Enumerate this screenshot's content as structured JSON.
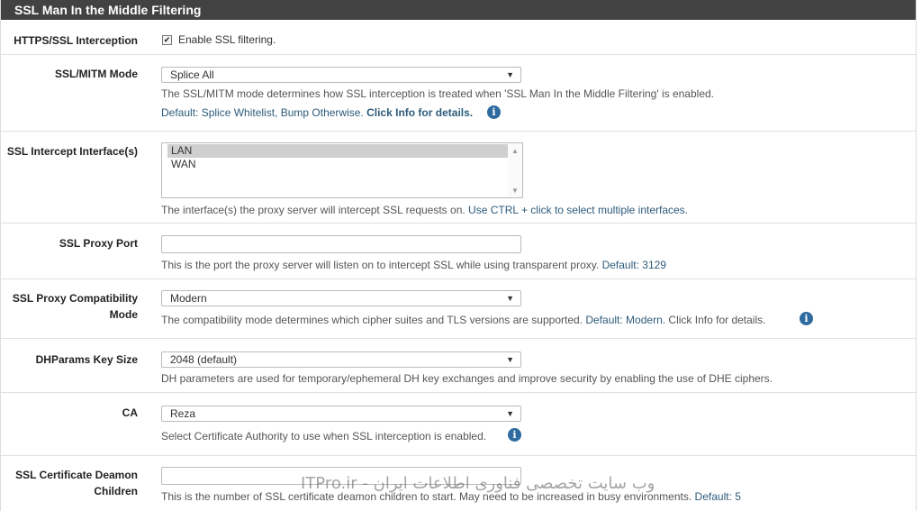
{
  "panel": {
    "title": "SSL Man In the Middle Filtering"
  },
  "https_interception": {
    "label": "HTTPS/SSL Interception",
    "checkbox_label": "Enable SSL filtering.",
    "checked": true
  },
  "mitm_mode": {
    "label": "SSL/MITM Mode",
    "value": "Splice All",
    "help": "The SSL/MITM mode determines how SSL interception is treated when 'SSL Man In the Middle Filtering' is enabled.",
    "default_text": "Default: Splice Whitelist, Bump Otherwise.",
    "info_link": "Click Info for details."
  },
  "intercept_interfaces": {
    "label": "SSL Intercept Interface(s)",
    "options": [
      "LAN",
      "WAN"
    ],
    "selected": "LAN",
    "help_prefix": "The interface(s) the proxy server will intercept SSL requests on.",
    "help_suffix": "Use CTRL + click to select multiple interfaces."
  },
  "proxy_port": {
    "label": "SSL Proxy Port",
    "value": "",
    "help": "This is the port the proxy server will listen on to intercept SSL while using transparent proxy.",
    "default_text": "Default: 3129"
  },
  "compat_mode": {
    "label_line1": "SSL Proxy Compatibility",
    "label_line2": "Mode",
    "value": "Modern",
    "help": "The compatibility mode determines which cipher suites and TLS versions are supported.",
    "default_text": "Default: Modern.",
    "info_text": "Click Info for details."
  },
  "dhparams": {
    "label": "DHParams Key Size",
    "value": "2048 (default)",
    "help": "DH parameters are used for temporary/ephemeral DH key exchanges and improve security by enabling the use of DHE ciphers."
  },
  "ca": {
    "label": "CA",
    "value": "Reza",
    "help": "Select Certificate Authority to use when SSL interception is enabled."
  },
  "cert_daemon": {
    "label_line1": "SSL Certificate Deamon",
    "label_line2": "Children",
    "value": "",
    "help": "This is the number of SSL certificate deamon children to start. May need to be increased in busy environments.",
    "default_text": "Default: 5"
  },
  "watermark": {
    "text": "ITPro.ir - وب سایت تخصصی فناوری اطلاعات ایران"
  },
  "icons": {
    "info": "info-circle-icon",
    "caret": "caret-down-icon",
    "check": "check-icon"
  },
  "colors": {
    "header_bg": "#424242",
    "accent": "#2d5b7b",
    "info_icon": "#2d6a9f"
  }
}
